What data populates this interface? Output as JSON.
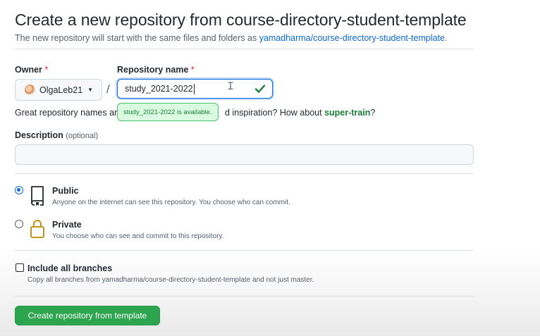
{
  "header": {
    "title": "Create a new repository from course-directory-student-template",
    "subtitle_prefix": "The new repository will start with the same files and folders as ",
    "template_link": "yamadharma/course-directory-student-template",
    "subtitle_suffix": "."
  },
  "owner": {
    "label": "Owner",
    "required_mark": "*",
    "value": "OlgaLeb21"
  },
  "repository_name": {
    "label": "Repository name",
    "required_mark": "*",
    "value": "study_2021-2022",
    "availability_tooltip": "study_2021-2022 is available.",
    "separator": "/"
  },
  "hint": {
    "prefix": "Great repository names are",
    "middle": "d inspiration? How about ",
    "suggestion": "super-train",
    "suffix": "?"
  },
  "description": {
    "label": "Description",
    "optional_note": "(optional)",
    "value": ""
  },
  "visibility": {
    "options": [
      {
        "title": "Public",
        "description": "Anyone on the internet can see this repository. You choose who can commit.",
        "selected": true,
        "icon": "repo-icon"
      },
      {
        "title": "Private",
        "description": "You choose who can see and commit to this repository.",
        "selected": false,
        "icon": "lock-icon"
      }
    ]
  },
  "branches": {
    "label": "Include all branches",
    "description": "Copy all branches from yamadharma/course-directory-student-template and not just master.",
    "checked": false
  },
  "actions": {
    "create_label": "Create repository from template"
  },
  "colors": {
    "primary_green": "#2da44e",
    "link_blue": "#0969da",
    "success_green": "#1a7f37",
    "required_red": "#cf222e"
  }
}
